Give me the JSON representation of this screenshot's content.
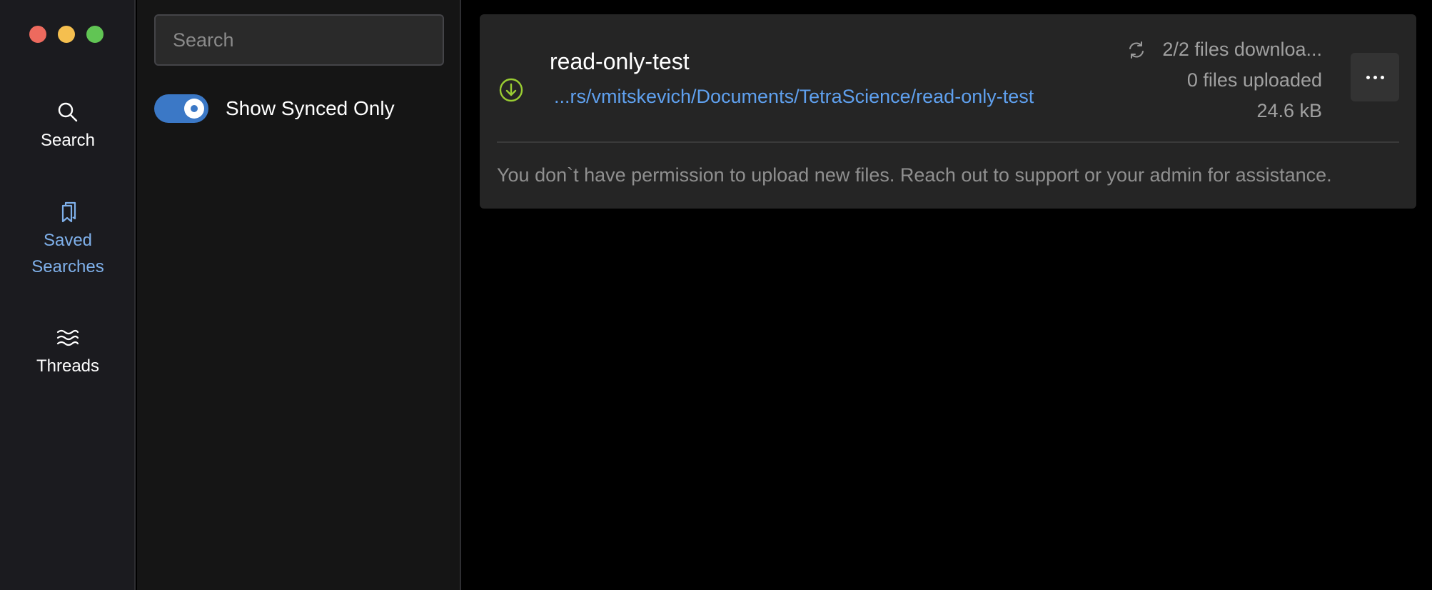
{
  "rail": {
    "items": [
      {
        "label": "Search",
        "icon": "search-icon"
      },
      {
        "label": "Saved Searches",
        "icon": "bookmarks-icon",
        "active": true
      },
      {
        "label": "Threads",
        "icon": "threads-icon"
      }
    ]
  },
  "filter": {
    "search_placeholder": "Search",
    "toggle_label": "Show Synced Only",
    "toggle_on": true
  },
  "card": {
    "title": "read-only-test",
    "path": "...rs/vmitskevich/Documents/TetraScience/read-only-test",
    "downloaded": "2/2 files downloa...",
    "uploaded": "0 files uploaded",
    "size": "24.6 kB",
    "note": "You don`t have permission to upload new files. Reach out to support or your admin for assistance."
  },
  "colors": {
    "accent": "#3b78c6",
    "link": "#5fa0ee",
    "active_nav": "#7fb0ea",
    "download_icon": "#9acd32"
  }
}
